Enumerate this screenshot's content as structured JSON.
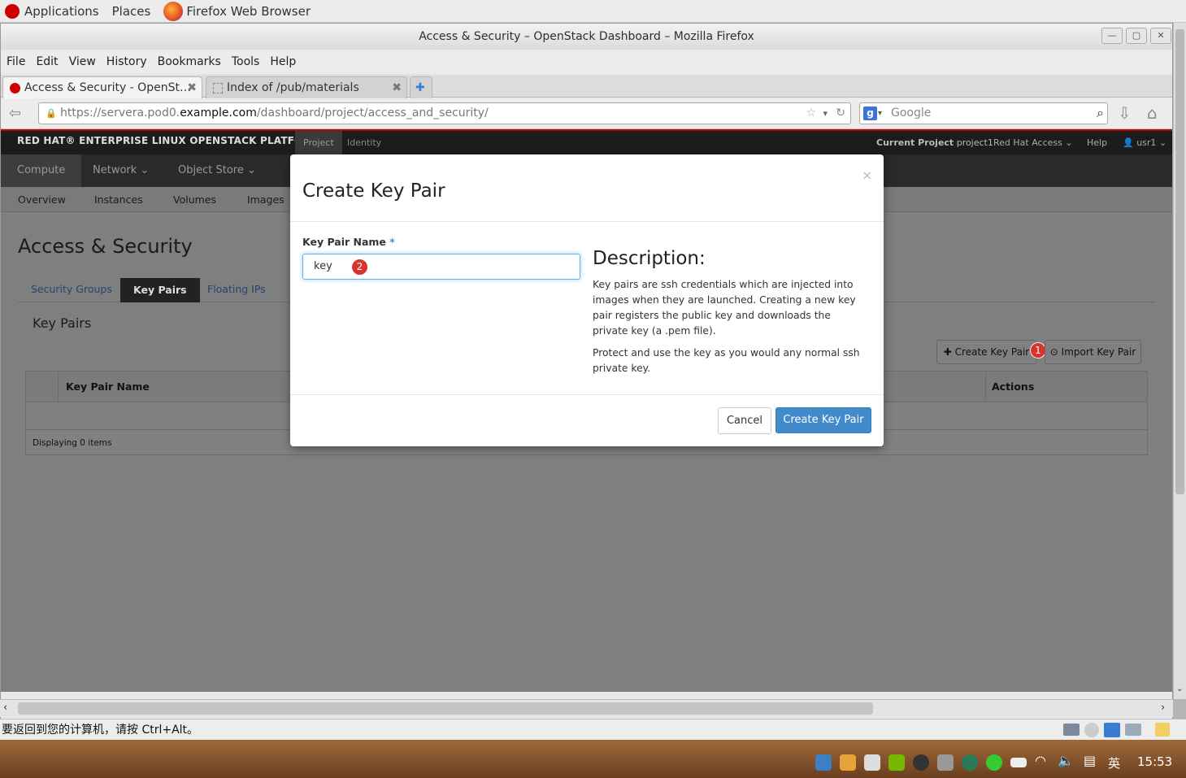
{
  "gnome_panel": {
    "applications": "Applications",
    "places": "Places",
    "browser": "Firefox Web Browser"
  },
  "window": {
    "title": "Access & Security – OpenStack Dashboard – Mozilla Firefox"
  },
  "menubar": [
    "File",
    "Edit",
    "View",
    "History",
    "Bookmarks",
    "Tools",
    "Help"
  ],
  "tabs": [
    {
      "label": "Access & Security - OpenSt…",
      "active": true
    },
    {
      "label": "Index of /pub/materials",
      "active": false
    }
  ],
  "navbar": {
    "url_prefix": "https://servera.pod0.",
    "url_host": "example.com",
    "url_path": "/dashboard/project/access_and_security/",
    "search_placeholder": "Google"
  },
  "dashboard": {
    "brand": "RED HAT® ENTERPRISE LINUX OPENSTACK PLATFORM",
    "top_tabs": [
      "Project",
      "Identity"
    ],
    "current_project_label": "Current Project",
    "current_project": "project1",
    "red_hat_access": "Red Hat Access",
    "help": "Help",
    "user": "usr1",
    "subnav": [
      "Compute",
      "Network",
      "Object Store"
    ],
    "subnav2": [
      "Overview",
      "Instances",
      "Volumes",
      "Images"
    ],
    "page_title": "Access & Security",
    "section_tabs": [
      "Security Groups",
      "Key Pairs",
      "Floating IPs"
    ],
    "panel_title": "Key Pairs",
    "create_btn": "Create Key Pair",
    "import_btn": "Import Key Pair",
    "col_name": "Key Pair Name",
    "col_actions": "Actions",
    "footer": "Displaying 0 items",
    "badge1": "1"
  },
  "modal": {
    "title": "Create Key Pair",
    "close": "×",
    "field_label": "Key Pair Name",
    "required_mark": "*",
    "field_value": "key",
    "badge2": "2",
    "desc_title": "Description:",
    "desc_p1": "Key pairs are ssh credentials which are injected into images when they are launched. Creating a new key pair registers the public key and downloads the private key (a .pem file).",
    "desc_p2": "Protect and use the key as you would any normal ssh private key.",
    "cancel": "Cancel",
    "submit": "Create Key Pair"
  },
  "vm_status": "要返回到您的计算机，请按 Ctrl+Alt。",
  "taskbar": {
    "time": "15:53",
    "ime": "英"
  },
  "colors": {
    "primary_blue": "#428bca",
    "link_blue": "#3a6fa8",
    "badge_red": "#d9342b",
    "rh_red": "#cc0000"
  }
}
